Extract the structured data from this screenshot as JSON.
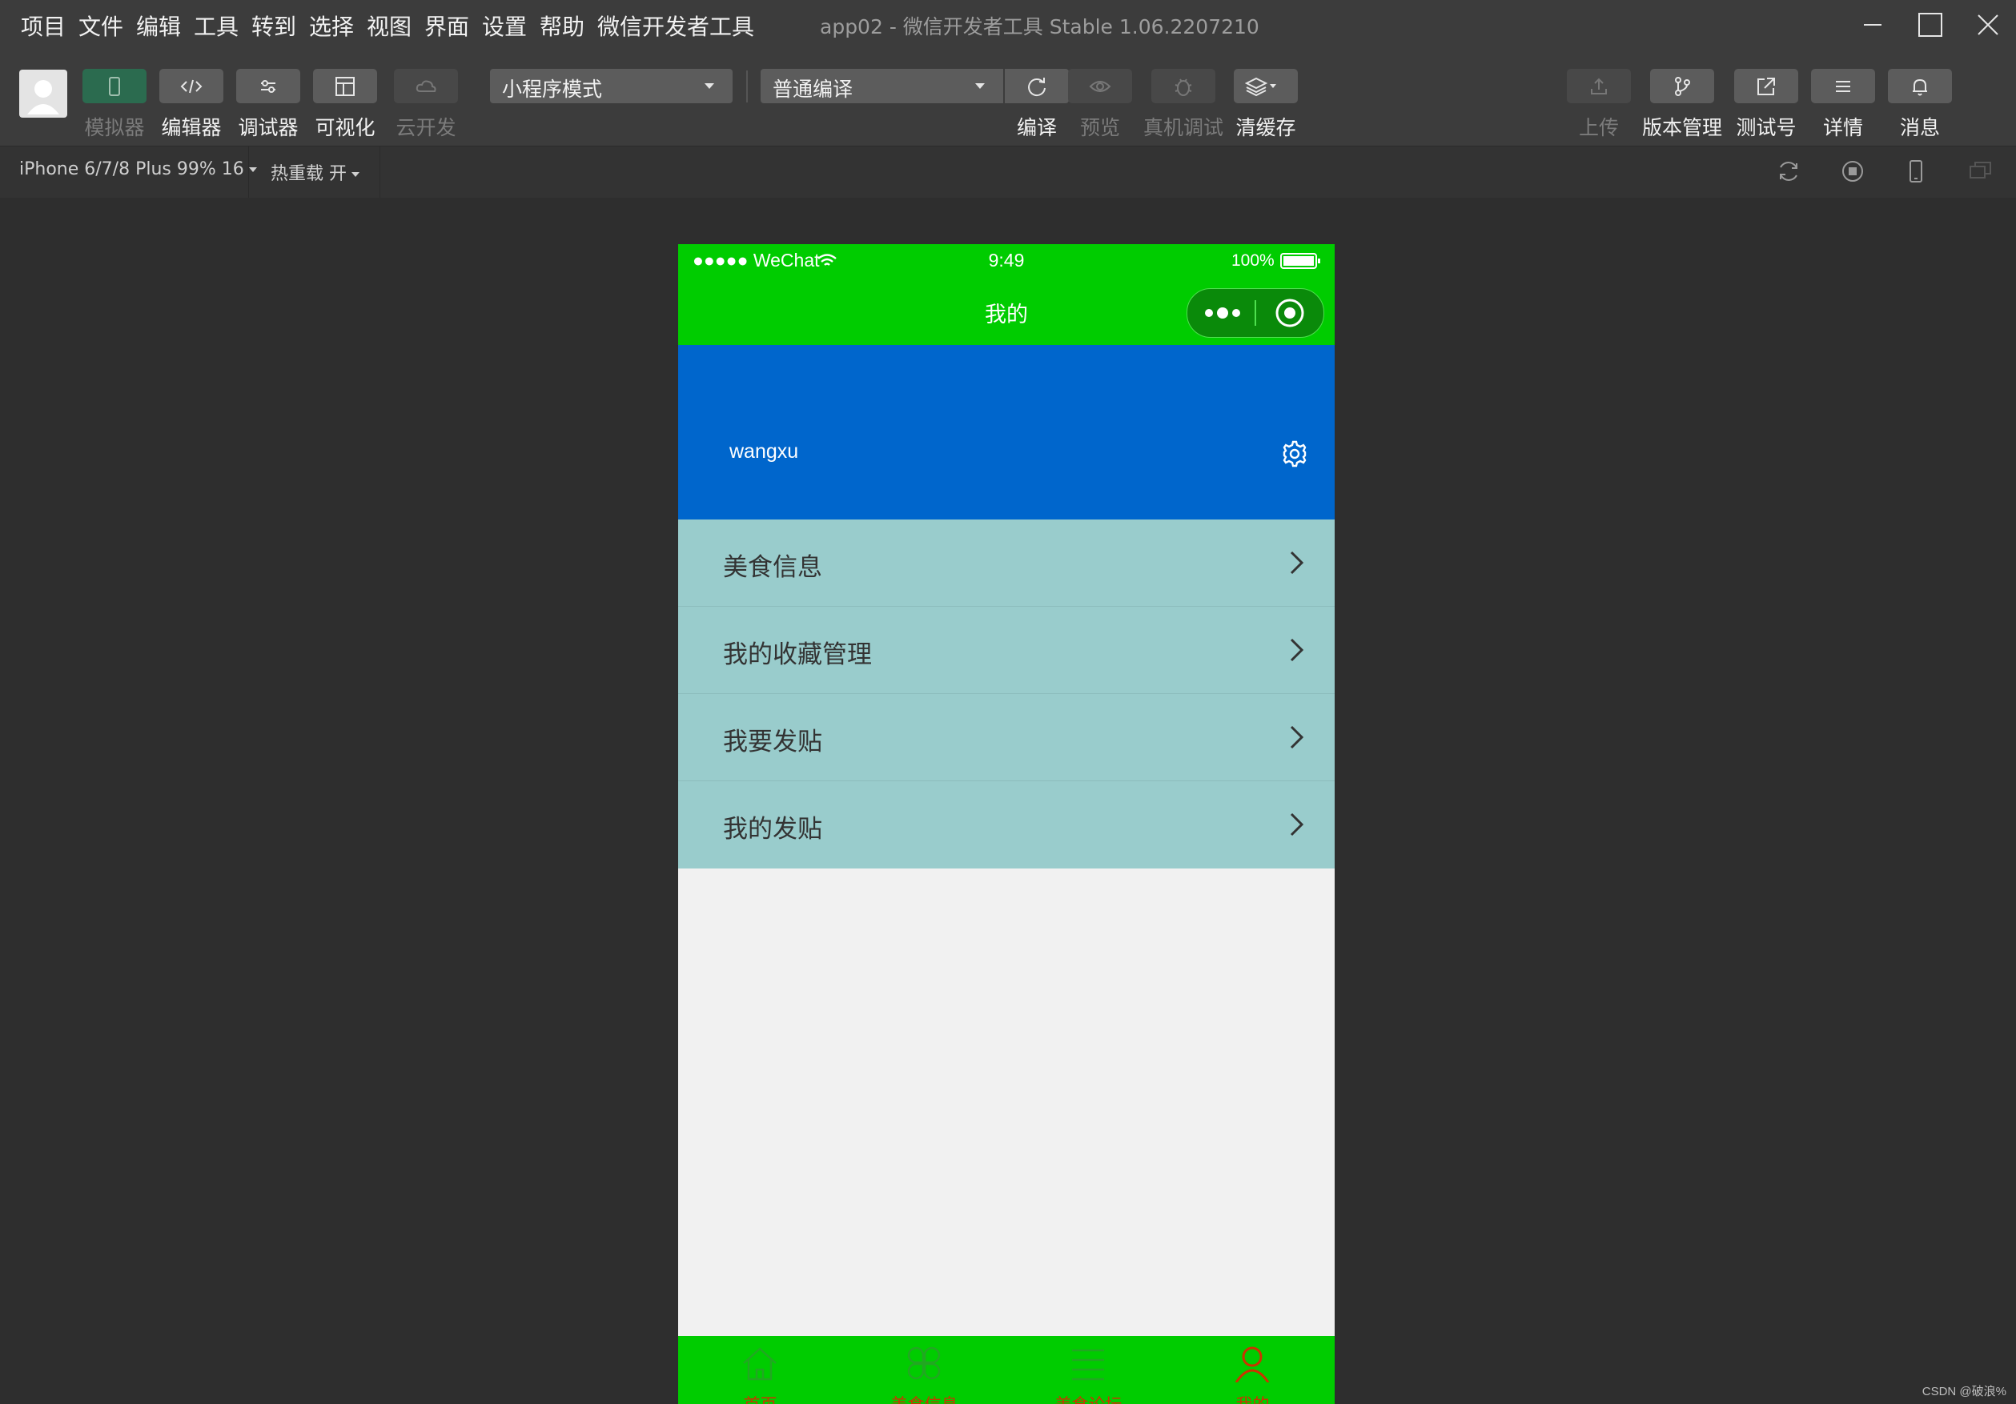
{
  "menubar": {
    "items": [
      "项目",
      "文件",
      "编辑",
      "工具",
      "转到",
      "选择",
      "视图",
      "界面",
      "设置",
      "帮助",
      "微信开发者工具"
    ],
    "window_title": "app02 - 微信开发者工具 Stable 1.06.2207210"
  },
  "toolbar": {
    "left_buttons": [
      {
        "label": "模拟器",
        "icon": "phone-icon",
        "active": true,
        "enabled": false
      },
      {
        "label": "编辑器",
        "icon": "code-icon",
        "enabled": true
      },
      {
        "label": "调试器",
        "icon": "sliders-icon",
        "enabled": true
      },
      {
        "label": "可视化",
        "icon": "layout-icon",
        "enabled": true
      },
      {
        "label": "云开发",
        "icon": "cloud-icon",
        "enabled": false
      }
    ],
    "mode_select": "小程序模式",
    "compile_select": "普通编译",
    "mid_buttons": [
      {
        "label": "编译",
        "icon": "refresh-icon",
        "enabled": true
      },
      {
        "label": "预览",
        "icon": "eye-icon",
        "enabled": false
      },
      {
        "label": "真机调试",
        "icon": "bug-icon",
        "enabled": false
      },
      {
        "label": "清缓存",
        "icon": "layers-icon",
        "enabled": true
      }
    ],
    "right_buttons": [
      {
        "label": "上传",
        "icon": "upload-icon",
        "enabled": false
      },
      {
        "label": "版本管理",
        "icon": "branch-icon",
        "enabled": true
      },
      {
        "label": "测试号",
        "icon": "external-link-icon",
        "enabled": true
      },
      {
        "label": "详情",
        "icon": "menu-icon",
        "enabled": true
      },
      {
        "label": "消息",
        "icon": "bell-icon",
        "enabled": true
      }
    ]
  },
  "devicebar": {
    "device": "iPhone 6/7/8 Plus 99% 16",
    "hot_reload": "热重载 开"
  },
  "phone": {
    "status": {
      "carrier": "●●●●● WeChat",
      "time": "9:49",
      "battery": "100%"
    },
    "nav_title": "我的",
    "username": "wangxu",
    "menu": [
      "美食信息",
      "我的收藏管理",
      "我要发贴",
      "我的发贴"
    ],
    "tabs": [
      {
        "label": "首页",
        "icon": "home-icon"
      },
      {
        "label": "美食信息",
        "icon": "clover-icon"
      },
      {
        "label": "美食论坛",
        "icon": "list-icon"
      },
      {
        "label": "我的",
        "icon": "user-icon"
      }
    ]
  },
  "watermark": "CSDN @破浪%",
  "colors": {
    "nav_green": "#00cc00",
    "profile_blue": "#0066cc",
    "menu_bg": "#99cccc",
    "tab_label": "#cc3300"
  }
}
